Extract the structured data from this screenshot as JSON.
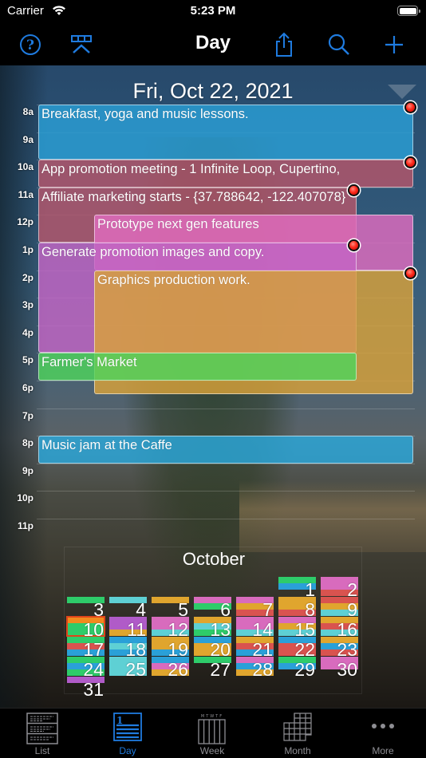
{
  "status_bar": {
    "carrier": "Carrier",
    "time": "5:23 PM"
  },
  "nav": {
    "title": "Day",
    "left_buttons": [
      "help-icon",
      "calendar-picker-icon"
    ],
    "right_buttons": [
      "share-icon",
      "search-icon",
      "add-icon"
    ],
    "accent": "#1f7bdf"
  },
  "day_view": {
    "date": "Fri, Oct 22, 2021",
    "hours": [
      "8a",
      "9a",
      "10a",
      "11a",
      "12p",
      "1p",
      "2p",
      "3p",
      "4p",
      "5p",
      "6p",
      "7p",
      "8p",
      "9p",
      "10p",
      "11p"
    ],
    "events": [
      {
        "title": "Breakfast, yoga and music lessons.",
        "start": 8.0,
        "end": 10.0,
        "col": "full",
        "color": "#2a9fd6",
        "alarm": true
      },
      {
        "title": "App promotion meeting - 1 Infinite Loop, Cupertino,",
        "start": 10.0,
        "end": 11.0,
        "col": "full",
        "color": "#b5566b",
        "alarm": true
      },
      {
        "title": "Affiliate marketing starts - {37.788642, -122.407078}",
        "start": 11.0,
        "end": 13.0,
        "col": "left",
        "color": "#b5566b",
        "alarm": true
      },
      {
        "title": "Prototype next gen features",
        "start": 12.0,
        "end": 14.0,
        "col": "right",
        "color": "#e06cbf",
        "alarm": false
      },
      {
        "title": "Generate promotion images and copy.",
        "start": 13.0,
        "end": 17.0,
        "col": "left",
        "color": "#c465c4",
        "alarm": true
      },
      {
        "title": "Graphics production work.",
        "start": 14.0,
        "end": 18.5,
        "col": "right",
        "color": "#d9a23a",
        "alarm": true
      },
      {
        "title": "Farmer's Market",
        "start": 17.0,
        "end": 18.0,
        "col": "left",
        "color": "#4ed45c",
        "alarm": false
      },
      {
        "title": "Music jam at the Caffe",
        "start": 20.0,
        "end": 21.0,
        "col": "full",
        "color": "#2aa8dc",
        "alarm": false
      }
    ]
  },
  "mini_calendar": {
    "month": "October",
    "first_weekday": 5,
    "today": 10,
    "palette": {
      "g": "#2ecc6a",
      "b": "#2aa0d8",
      "c": "#5ed0d4",
      "p": "#d86bbd",
      "r": "#d9534f",
      "y": "#e0a52e",
      "v": "#b05bc8",
      "o": "#f28a1e"
    },
    "days": [
      {
        "n": "1",
        "s": "gb"
      },
      {
        "n": "2",
        "s": "ppr"
      },
      {
        "n": "3",
        "s": "g"
      },
      {
        "n": "4",
        "s": "c"
      },
      {
        "n": "5",
        "s": "y"
      },
      {
        "n": "6",
        "s": "pg"
      },
      {
        "n": "7",
        "s": "pyr"
      },
      {
        "n": "8",
        "s": "yyr"
      },
      {
        "n": "9",
        "s": "ryc"
      },
      {
        "n": "10",
        "s": "ogg"
      },
      {
        "n": "11",
        "s": "vvy"
      },
      {
        "n": "12",
        "s": "ppc"
      },
      {
        "n": "13",
        "s": "ycg"
      },
      {
        "n": "14",
        "s": "ppc"
      },
      {
        "n": "15",
        "s": "pyc"
      },
      {
        "n": "16",
        "s": "yrc"
      },
      {
        "n": "17",
        "s": "grb"
      },
      {
        "n": "18",
        "s": "bcb"
      },
      {
        "n": "19",
        "s": "yyb"
      },
      {
        "n": "20",
        "s": "byy"
      },
      {
        "n": "21",
        "s": "yrb"
      },
      {
        "n": "22",
        "s": "brr"
      },
      {
        "n": "23",
        "s": "ybr"
      },
      {
        "n": "24",
        "s": "gbg"
      },
      {
        "n": "25",
        "s": "ccc"
      },
      {
        "n": "26",
        "s": "bpy"
      },
      {
        "n": "27",
        "s": "g"
      },
      {
        "n": "28",
        "s": "pby"
      },
      {
        "n": "29",
        "s": "gb"
      },
      {
        "n": "30",
        "s": "pp"
      },
      {
        "n": "31",
        "s": "v"
      }
    ]
  },
  "tab_bar": {
    "tabs": [
      {
        "label": "List",
        "icon": "list-icon",
        "active": false
      },
      {
        "label": "Day",
        "icon": "day-icon",
        "active": true
      },
      {
        "label": "Week",
        "icon": "week-icon",
        "active": false
      },
      {
        "label": "Month",
        "icon": "month-icon",
        "active": false
      },
      {
        "label": "More",
        "icon": "more-icon",
        "active": false
      }
    ]
  }
}
